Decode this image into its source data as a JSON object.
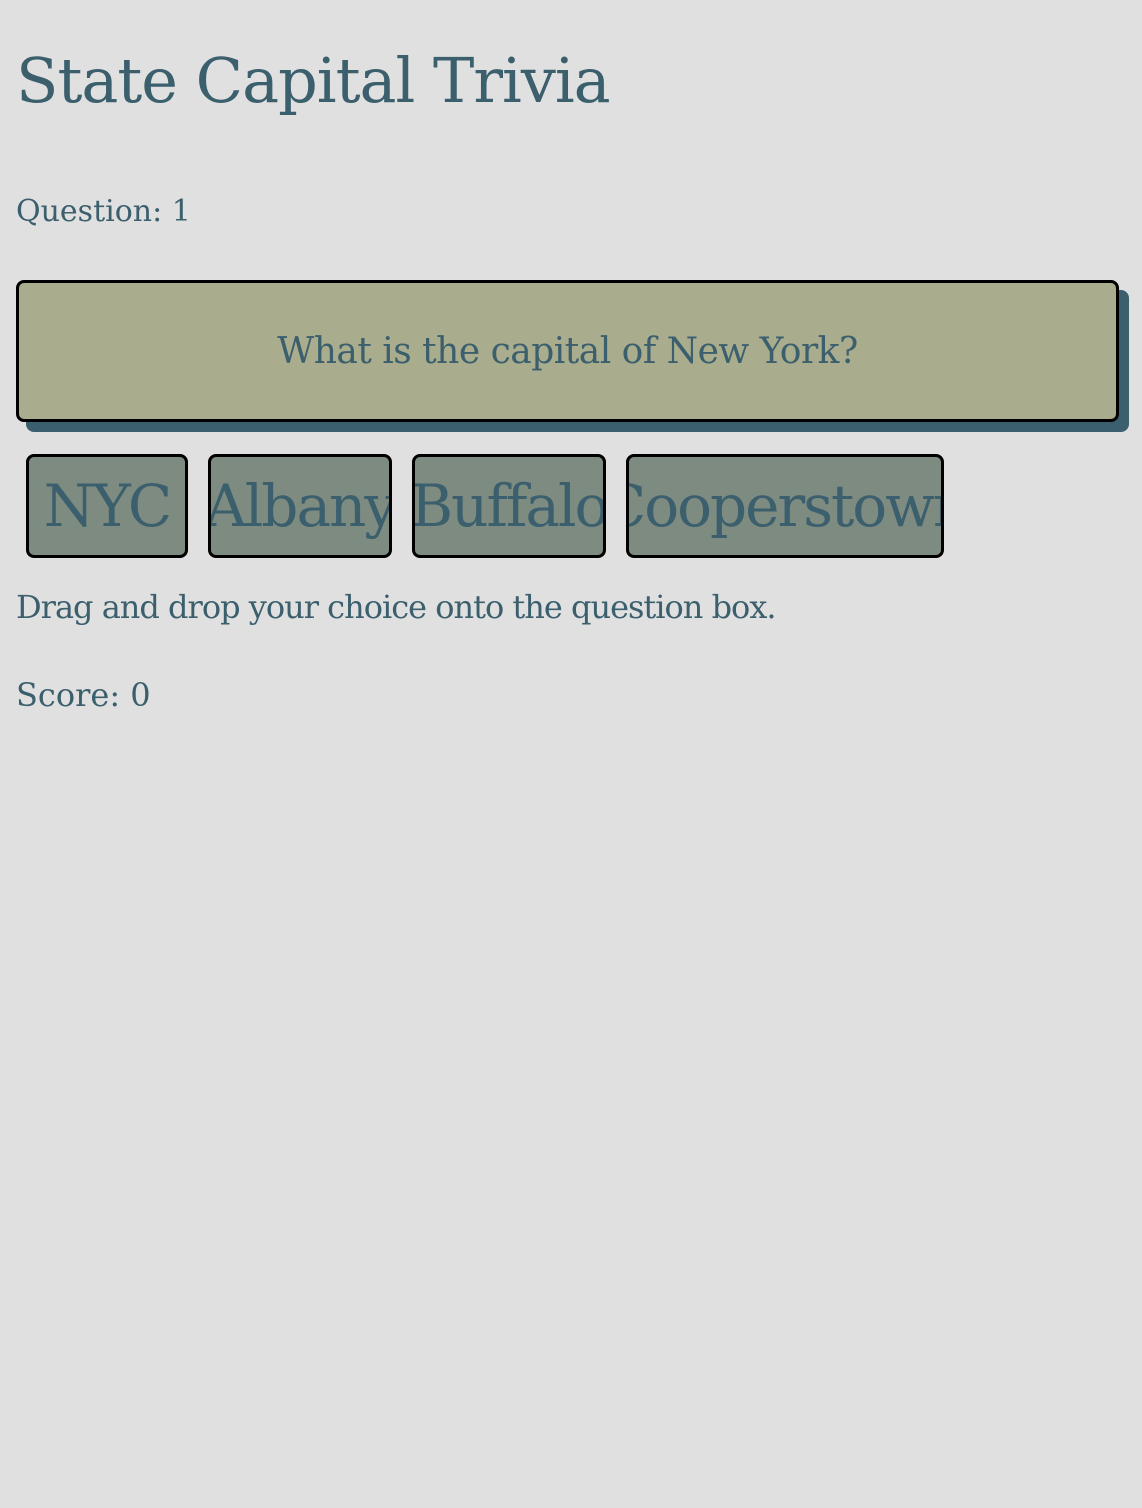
{
  "title": "State Capital Trivia",
  "question_label": "Question: 1",
  "question": {
    "text": "What is the capital of New York?"
  },
  "choices": [
    {
      "label": "NYC"
    },
    {
      "label": "Albany"
    },
    {
      "label": "Buffalo"
    },
    {
      "label": "Cooperstown"
    }
  ],
  "instructions": "Drag and drop your choice onto the question box.",
  "score_label": "Score: 0",
  "colors": {
    "background": "#e0e0e0",
    "text": "#3b5f6d",
    "question_box": "#a9ac8d",
    "choice_box": "#7e8b80",
    "shadow": "#3b5f6d"
  }
}
